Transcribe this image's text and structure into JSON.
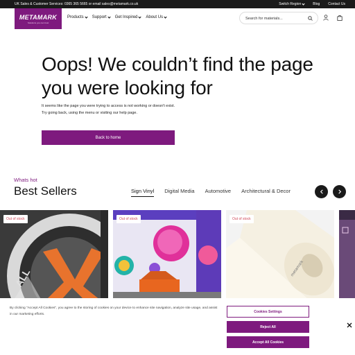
{
  "topbar": {
    "contact": "UK Sales & Customer Services: 0365 365 5665 or email sales@metamark.co.uk",
    "switch_region": "Switch Region",
    "blog": "Blog",
    "contact_us": "Contact Us"
  },
  "header": {
    "logo_wordmark": "METAMARK",
    "logo_tagline": "Solutions you can trust",
    "nav": [
      "Products",
      "Support",
      "Get Inspired",
      "About Us"
    ],
    "search_placeholder": "Search for materials..."
  },
  "hero": {
    "title": "Oops! We couldn’t find the page you were looking for",
    "description": "It seems like the page you were trying to access is not working or doesn't exist. Try going back, using the menu or visiting our help page.",
    "button": "Back to home"
  },
  "bestsellers": {
    "eyebrow": "Whats hot",
    "title": "Best Sellers",
    "tabs": [
      "Sign Vinyl",
      "Digital Media",
      "Automotive",
      "Architectural & Decor"
    ],
    "active_tab": "Sign Vinyl",
    "cards": [
      {
        "badge": "Out of stock"
      },
      {
        "badge": "Out of stock"
      },
      {
        "badge": "Out of stock"
      }
    ]
  },
  "cookie": {
    "text": "By clicking \"Accept All Cookies\", you agree to the storing of cookies on your device to enhance site navigation, analyze site usage, and assist in our marketing efforts.",
    "settings": "Cookies Settings",
    "reject": "Reject All",
    "accept": "Accept All Cookies"
  },
  "colors": {
    "brand": "#7e1a7e",
    "topbar": "#1a1a1a",
    "badge_text": "#d04a5a"
  }
}
